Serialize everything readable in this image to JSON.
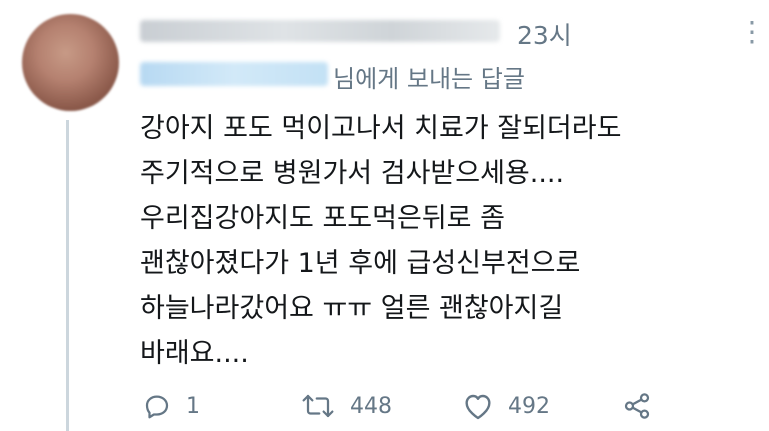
{
  "tweet": {
    "time": "23시",
    "reply_to_suffix": "님에게 보내는 답글",
    "lines": [
      "강아지 포도 먹이고나서 치료가 잘되더라도",
      "주기적으로 병원가서 검사받으세용....",
      "우리집강아지도 포도먹은뒤로 좀",
      "괜찮아졌다가 1년 후에 급성신부전으로",
      "하늘나라갔어요 ㅠㅠ  얼른 괜찮아지길",
      "바래요...."
    ],
    "actions": {
      "reply_count": "1",
      "retweet_count": "448",
      "like_count": "492"
    }
  },
  "icons": {
    "more": "more-vertical-icon",
    "reply": "reply-icon",
    "retweet": "retweet-icon",
    "like": "heart-icon",
    "share": "share-icon"
  },
  "colors": {
    "text": "#14171a",
    "muted": "#657786",
    "thread_line": "#ccd6dd"
  }
}
